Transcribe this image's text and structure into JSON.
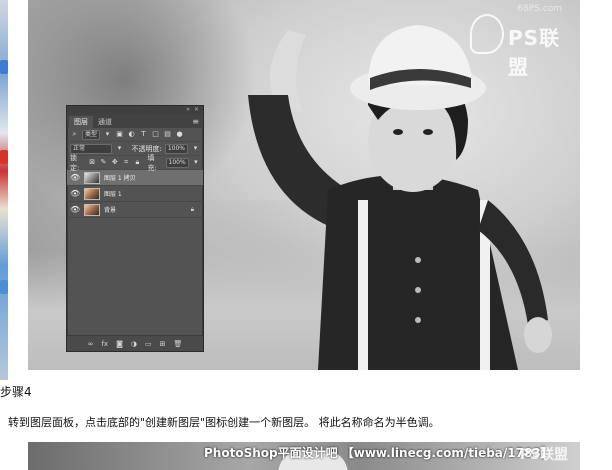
{
  "watermark": {
    "site": "68PS.com",
    "brand": "PS联盟"
  },
  "layers_panel": {
    "tabs": [
      "图层",
      "通道"
    ],
    "filter_kind": "类型",
    "blend_mode": "正常",
    "opacity_label": "不透明度:",
    "opacity_value": "100%",
    "lock_label": "锁定:",
    "fill_label": "填充:",
    "fill_value": "100%",
    "layers": [
      {
        "name": "图层 1 拷贝",
        "visible": true,
        "selected": true
      },
      {
        "name": "图层 1",
        "visible": true,
        "selected": false
      },
      {
        "name": "背景",
        "visible": true,
        "selected": false,
        "locked": true
      }
    ]
  },
  "article": {
    "step_title": "步骤4",
    "instruction": "转到图层面板，点击底部的\"创建新图层\"图标创建一个新图层。 将此名称命名为半色调。"
  },
  "bottom_banner": {
    "text": "PhotoShop平面设计吧 【www.linecg.com/tieba/1783】",
    "brand": "PS联盟"
  },
  "colors": {
    "panel_bg": "#535353",
    "panel_dark": "#424242",
    "selected_row": "#6f6f6f"
  }
}
